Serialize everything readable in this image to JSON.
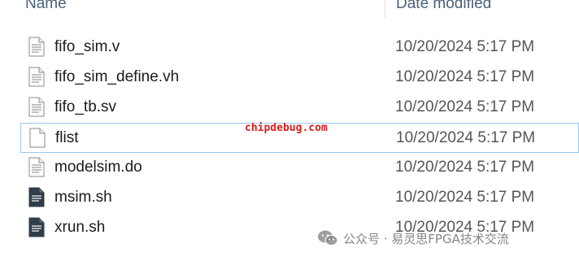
{
  "header": {
    "name_label": "Name",
    "date_label": "Date modified"
  },
  "files": [
    {
      "name": "fifo_sim.v",
      "date": "10/20/2024 5:17 PM",
      "icon": "text-file-icon"
    },
    {
      "name": "fifo_sim_define.vh",
      "date": "10/20/2024 5:17 PM",
      "icon": "text-file-icon"
    },
    {
      "name": "fifo_tb.sv",
      "date": "10/20/2024 5:17 PM",
      "icon": "text-file-icon"
    },
    {
      "name": "flist",
      "date": "10/20/2024 5:17 PM",
      "icon": "blank-file-icon"
    },
    {
      "name": "modelsim.do",
      "date": "10/20/2024 5:17 PM",
      "icon": "text-file-icon"
    },
    {
      "name": "msim.sh",
      "date": "10/20/2024 5:17 PM",
      "icon": "script-file-icon"
    },
    {
      "name": "xrun.sh",
      "date": "10/20/2024 5:17 PM",
      "icon": "script-file-icon"
    }
  ],
  "watermarks": {
    "site": "chipdebug.com",
    "wechat": "公众号 · 易灵思FPGA技术交流"
  },
  "colors": {
    "header_text": "#4c607a",
    "focus_border": "#99c9ef",
    "watermark_red": "#d81e1e"
  }
}
